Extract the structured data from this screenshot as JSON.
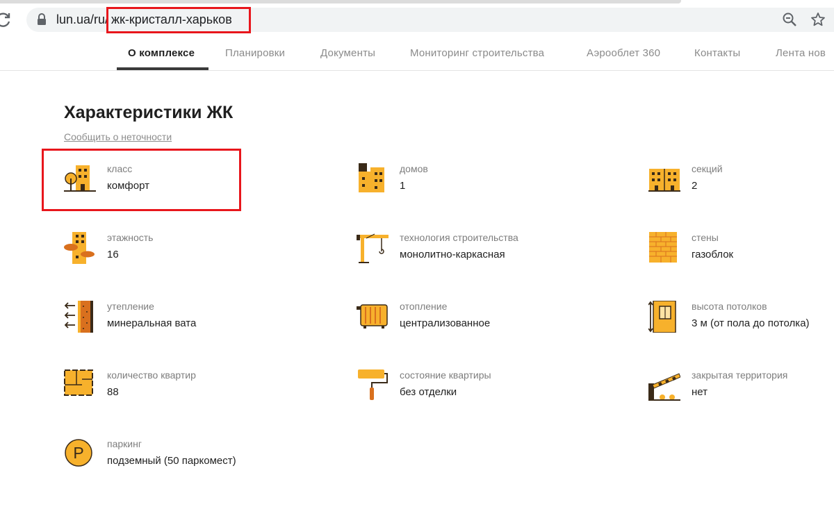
{
  "browser": {
    "url_domain": "lun.ua/ru/",
    "url_path": "жк-кристалл-харьков"
  },
  "tabs": [
    {
      "label": "О комплексе",
      "active": true
    },
    {
      "label": "Планировки",
      "active": false
    },
    {
      "label": "Документы",
      "active": false
    },
    {
      "label": "Мониторинг строительства",
      "active": false
    },
    {
      "label": "Аэрооблет 360",
      "active": false
    },
    {
      "label": "Контакты",
      "active": false
    },
    {
      "label": "Лента нов",
      "active": false
    }
  ],
  "section": {
    "title": "Характеристики ЖК",
    "report_link": "Сообщить о неточности"
  },
  "features": [
    {
      "label": "класс",
      "value": "комфорт",
      "icon": "building-tree-icon"
    },
    {
      "label": "домов",
      "value": "1",
      "icon": "buildings-icon"
    },
    {
      "label": "секций",
      "value": "2",
      "icon": "sections-icon"
    },
    {
      "label": "этажность",
      "value": "16",
      "icon": "tall-building-clouds-icon"
    },
    {
      "label": "технология строительства",
      "value": "монолитно-каркасная",
      "icon": "crane-icon"
    },
    {
      "label": "стены",
      "value": "газоблок",
      "icon": "brick-wall-icon"
    },
    {
      "label": "утепление",
      "value": "минеральная вата",
      "icon": "insulation-icon"
    },
    {
      "label": "отопление",
      "value": "централизованное",
      "icon": "radiator-icon"
    },
    {
      "label": "высота потолков",
      "value": "3 м (от пола до потолка)",
      "icon": "ceiling-height-icon"
    },
    {
      "label": "количество квартир",
      "value": "88",
      "icon": "floor-plan-icon"
    },
    {
      "label": "состояние квартиры",
      "value": "без отделки",
      "icon": "paint-roller-icon"
    },
    {
      "label": "закрытая территория",
      "value": "нет",
      "icon": "barrier-gate-icon"
    },
    {
      "label": "паркинг",
      "value": "подземный (50 паркомест)",
      "icon": "parking-icon"
    }
  ],
  "colors": {
    "accent_orange": "#f7b12c",
    "icon_outline": "#3a2a18",
    "highlight_red": "#e8161c"
  }
}
